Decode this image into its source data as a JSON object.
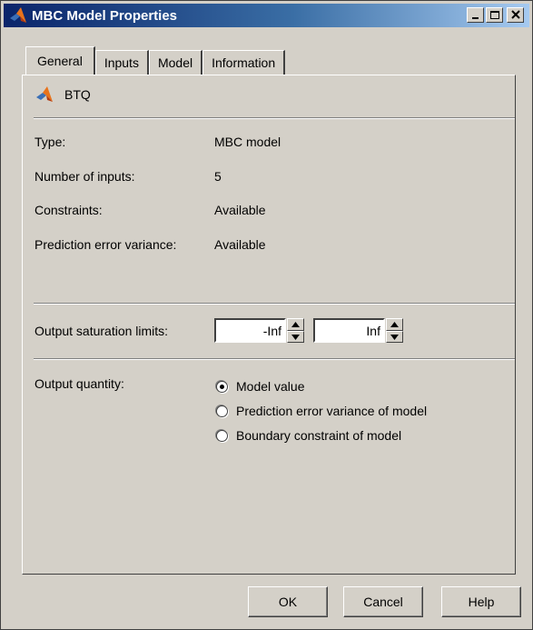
{
  "window": {
    "title": "MBC Model Properties"
  },
  "tabs": [
    {
      "label": "General",
      "active": true
    },
    {
      "label": "Inputs",
      "active": false
    },
    {
      "label": "Model",
      "active": false
    },
    {
      "label": "Information",
      "active": false
    }
  ],
  "general": {
    "model_name": "BTQ",
    "type_label": "Type:",
    "type_value": "MBC model",
    "num_inputs_label": "Number of inputs:",
    "num_inputs_value": "5",
    "constraints_label": "Constraints:",
    "constraints_value": "Available",
    "pev_label": "Prediction error variance:",
    "pev_value": "Available",
    "saturation_label": "Output saturation limits:",
    "saturation_lower": "-Inf",
    "saturation_upper": "Inf",
    "output_quantity_label": "Output quantity:",
    "output_options": [
      {
        "label": "Model value",
        "selected": true
      },
      {
        "label": "Prediction error variance of model",
        "selected": false
      },
      {
        "label": "Boundary constraint of model",
        "selected": false
      }
    ]
  },
  "buttons": {
    "ok": "OK",
    "cancel": "Cancel",
    "help": "Help"
  },
  "colors": {
    "titlebar_start": "#0a246a",
    "titlebar_end": "#a6caf0",
    "face": "#d4d0c8"
  }
}
